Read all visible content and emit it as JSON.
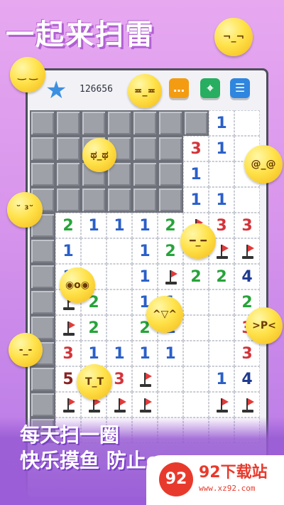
{
  "app": {
    "title": "一起来扫雷"
  },
  "topbar": {
    "score": "126656",
    "buttons": [
      {
        "name": "chat-button",
        "glyph": "…",
        "color": "#f39c12"
      },
      {
        "name": "location-button",
        "glyph": "⌖",
        "color": "#27ae60"
      },
      {
        "name": "menu-button",
        "glyph": "☰",
        "color": "#2f86de"
      }
    ]
  },
  "board": {
    "rows": [
      [
        "#",
        "#",
        "#",
        "#",
        "#",
        "#",
        "#",
        "1",
        " "
      ],
      [
        "#",
        "#",
        "#",
        "#",
        "#",
        "#",
        "3",
        "1",
        " "
      ],
      [
        "#",
        "#",
        "#",
        "#",
        "#",
        "#",
        "1",
        " ",
        " "
      ],
      [
        "#",
        "#",
        "#",
        "#",
        "#",
        "#",
        "1",
        "1",
        " "
      ],
      [
        "#",
        "2",
        "1",
        "1",
        "1",
        "2",
        "F",
        "3",
        "3"
      ],
      [
        "#",
        "1",
        " ",
        " ",
        "1",
        "2",
        " ",
        "F",
        "F"
      ],
      [
        "#",
        "1",
        " ",
        " ",
        "1",
        "F",
        "2",
        "2",
        "4"
      ],
      [
        "#",
        "F",
        "2",
        " ",
        "1",
        "1",
        " ",
        " ",
        "2"
      ],
      [
        "#",
        "F",
        "2",
        " ",
        "2",
        "1",
        " ",
        " ",
        "3"
      ],
      [
        "#",
        "3",
        "1",
        "1",
        "1",
        "1",
        " ",
        " ",
        "3"
      ],
      [
        "#",
        "5",
        " ",
        "3",
        "F",
        " ",
        " ",
        "1",
        "4"
      ],
      [
        "#",
        "F",
        "F",
        "F",
        "F",
        " ",
        " ",
        "F",
        "F"
      ],
      [
        "#",
        " ",
        " ",
        " ",
        " ",
        " ",
        " ",
        " ",
        " "
      ]
    ]
  },
  "colors": {
    "accent": "#b15fd2",
    "flag": "#e23a3a"
  },
  "slogan": {
    "line1": "每天扫一圈",
    "line2": "快乐摸鱼  防止emo~"
  },
  "watermark": {
    "title": "92下载站",
    "url": "www.xz92.com",
    "logo": "92"
  },
  "emojis": [
    {
      "name": "smirk-emoji",
      "face": "¬_¬"
    },
    {
      "name": "sleepy-emoji",
      "face": "‿ ‿"
    },
    {
      "name": "awkward-emoji",
      "face": "≖_≖"
    },
    {
      "name": "crying-emoji",
      "face": "ಥ_ಥ"
    },
    {
      "name": "dizzy-emoji",
      "face": "@_@"
    },
    {
      "name": "kiss-emoji",
      "face": "˘ ³˘"
    },
    {
      "name": "annoyed-emoji",
      "face": "━_━"
    },
    {
      "name": "surprised-emoji",
      "face": "◉o◉"
    },
    {
      "name": "grin-emoji",
      "face": "^▽^"
    },
    {
      "name": "tongue-emoji",
      "face": ">P<"
    },
    {
      "name": "neutral-emoji",
      "face": "-_-"
    },
    {
      "name": "sob-emoji",
      "face": "T_T"
    }
  ]
}
